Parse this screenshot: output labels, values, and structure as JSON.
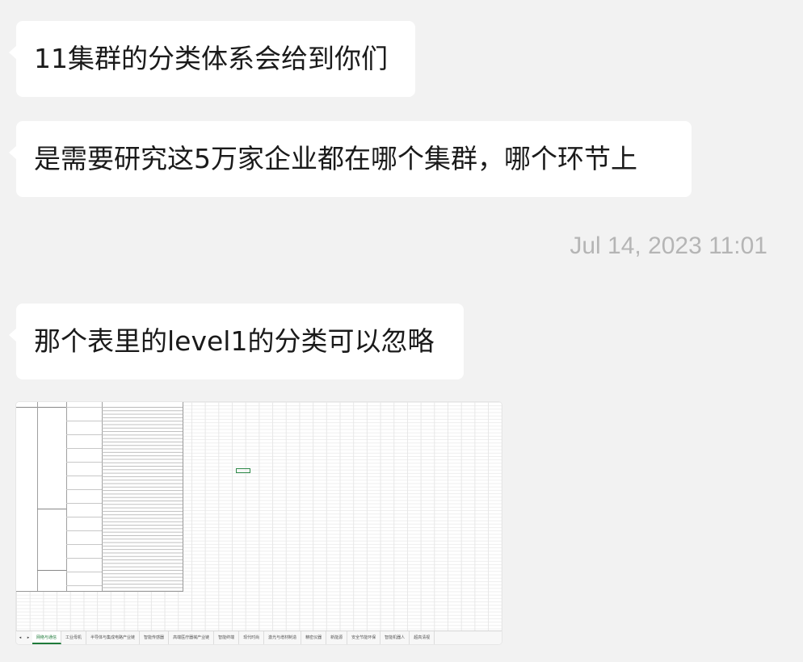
{
  "messages": [
    {
      "text": "11集群的分类体系会给到你们"
    },
    {
      "text": "是需要研究这5万家企业都在哪个集群，哪个环节上"
    },
    {
      "text": "那个表里的level1的分类可以忽略"
    }
  ],
  "timestamp": "Jul 14, 2023 11:01",
  "spreadsheet": {
    "tabs": [
      "网络与通信",
      "工业母机",
      "半导体与集成电路产业链",
      "智能传感器",
      "高端医疗器械产业链",
      "智能终端",
      "现代时尚",
      "激光与增材制造",
      "精密仪器",
      "新能源",
      "安全节能环保",
      "智能机器人",
      "超高清视"
    ],
    "active_tab": "网络与通信",
    "nav_prev": "◂",
    "nav_next": "▸"
  }
}
